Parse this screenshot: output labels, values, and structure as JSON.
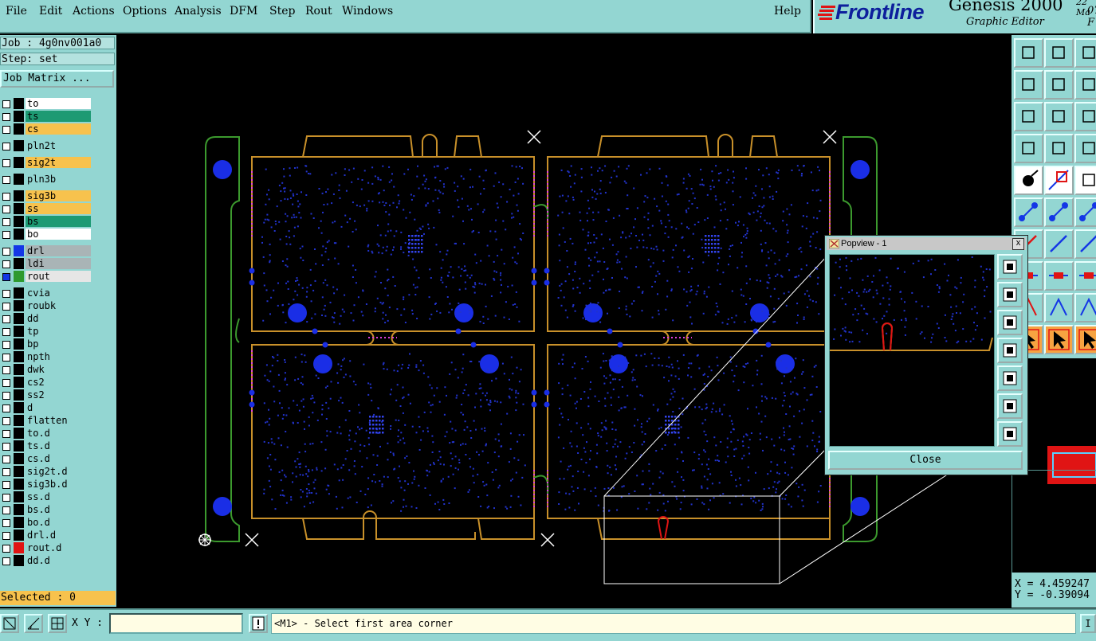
{
  "menu": {
    "items": [
      "File",
      "Edit",
      "Actions",
      "Options",
      "Analysis",
      "DFM",
      "Step",
      "Rout",
      "Windows"
    ],
    "help": "Help"
  },
  "brand": {
    "logo": "Frontline",
    "app_name": "Genesis 2000",
    "subtitle": "Graphic Editor",
    "clock_date": "22 Ma",
    "clock_time": "07: F"
  },
  "job": {
    "job_label": "Job : 4g0nv001a0",
    "step_label": "Step: set",
    "job_matrix_button": "Job Matrix ..."
  },
  "layers": [
    {
      "name": "to",
      "color": "#ffffff",
      "swatch": "#000000"
    },
    {
      "name": "ts",
      "color": "#1d9a73",
      "swatch": "#000000"
    },
    {
      "name": "cs",
      "color": "#f7c24d",
      "swatch": "#000000"
    },
    {
      "name": "pln2t",
      "color": "#93d6d2",
      "swatch": "#000000"
    },
    {
      "name": "sig2t",
      "color": "#f7c24d",
      "swatch": "#000000"
    },
    {
      "name": "pln3b",
      "color": "#93d6d2",
      "swatch": "#000000"
    },
    {
      "name": "sig3b",
      "color": "#f7c24d",
      "swatch": "#000000"
    },
    {
      "name": "ss",
      "color": "#f7c24d",
      "swatch": "#000000"
    },
    {
      "name": "bs",
      "color": "#1d9a73",
      "swatch": "#000000"
    },
    {
      "name": "bo",
      "color": "#ffffff",
      "swatch": "#000000"
    },
    {
      "name": "drl",
      "color": "#a9b4b6",
      "swatch": "#1436e6"
    },
    {
      "name": "ldi",
      "color": "#a9b4b6",
      "swatch": "#000000"
    },
    {
      "name": "rout",
      "color": "#e6e6e6",
      "swatch": "#2e9a2e"
    },
    {
      "name": "cvia",
      "color": "#93d6d2",
      "swatch": "#000000"
    },
    {
      "name": "roubk",
      "color": "#93d6d2",
      "swatch": "#000000"
    },
    {
      "name": "dd",
      "color": "#93d6d2",
      "swatch": "#000000"
    },
    {
      "name": "tp",
      "color": "#93d6d2",
      "swatch": "#000000"
    },
    {
      "name": "bp",
      "color": "#93d6d2",
      "swatch": "#000000"
    },
    {
      "name": "npth",
      "color": "#93d6d2",
      "swatch": "#000000"
    },
    {
      "name": "dwk",
      "color": "#93d6d2",
      "swatch": "#000000"
    },
    {
      "name": "cs2",
      "color": "#93d6d2",
      "swatch": "#000000"
    },
    {
      "name": "ss2",
      "color": "#93d6d2",
      "swatch": "#000000"
    },
    {
      "name": "d",
      "color": "#93d6d2",
      "swatch": "#000000"
    },
    {
      "name": "flatten",
      "color": "#93d6d2",
      "swatch": "#000000"
    },
    {
      "name": "to.d",
      "color": "#93d6d2",
      "swatch": "#000000"
    },
    {
      "name": "ts.d",
      "color": "#93d6d2",
      "swatch": "#000000"
    },
    {
      "name": "cs.d",
      "color": "#93d6d2",
      "swatch": "#000000"
    },
    {
      "name": "sig2t.d",
      "color": "#93d6d2",
      "swatch": "#000000"
    },
    {
      "name": "sig3b.d",
      "color": "#93d6d2",
      "swatch": "#000000"
    },
    {
      "name": "ss.d",
      "color": "#93d6d2",
      "swatch": "#000000"
    },
    {
      "name": "bs.d",
      "color": "#93d6d2",
      "swatch": "#000000"
    },
    {
      "name": "bo.d",
      "color": "#93d6d2",
      "swatch": "#000000"
    },
    {
      "name": "drl.d",
      "color": "#93d6d2",
      "swatch": "#000000"
    },
    {
      "name": "rout.d",
      "color": "#93d6d2",
      "swatch": "#e01414"
    },
    {
      "name": "dd.d",
      "color": "#93d6d2",
      "swatch": "#000000"
    }
  ],
  "selected_label": "Selected : 0",
  "bottom": {
    "xy_label": "X Y :",
    "xy_value": "",
    "prompt": "<M1> - Select first area corner",
    "right_stub": "I"
  },
  "coords": {
    "x": "X = 4.459247",
    "y": "Y = -0.39094"
  },
  "popview": {
    "title": "Popview - 1",
    "close_label": "Close",
    "close_x": "x"
  },
  "colors": {
    "panel": "#93d6d2",
    "outline": "#c8902a",
    "rout": "#3c9a2e",
    "pads": "#1a2ee6",
    "highlight": "#e01414"
  }
}
